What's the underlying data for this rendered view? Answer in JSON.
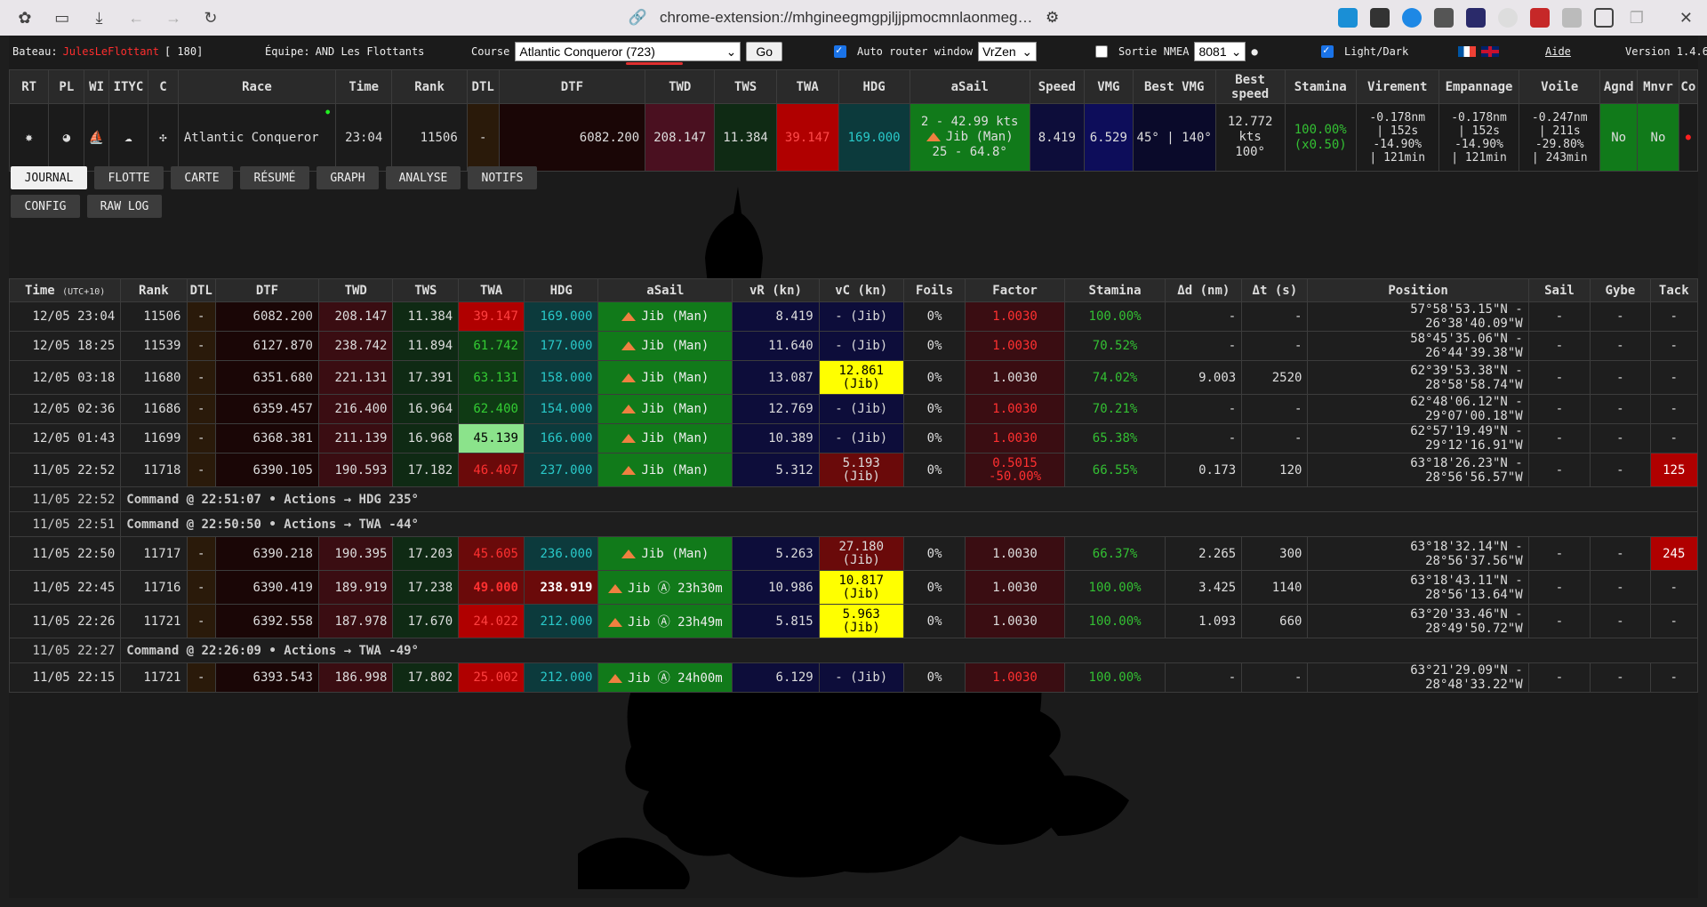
{
  "browser": {
    "url": "chrome-extension://mhgineegmgpjljjpmocmnlaonmegjkdc"
  },
  "topbar": {
    "bateau_label": "Bateau:",
    "bateau_name": "JulesLeFlottant",
    "bateau_extra": "[ 180]",
    "equipe_label": "Équipe:",
    "equipe_value": "AND Les Flottants",
    "course_label": "Course",
    "course_value": "Atlantic Conqueror (723)",
    "go_label": "Go",
    "auto_router_label": "Auto router window",
    "router_value": "VrZen",
    "sortie_label": "Sortie NMEA",
    "port_value": "8081",
    "lightdark_label": "Light/Dark",
    "aide_label": "Aide",
    "version_label": "Version 1.4.6"
  },
  "summary": {
    "headers": [
      "RT",
      "PL",
      "WI",
      "ITYC",
      "C",
      "Race",
      "Time",
      "Rank",
      "DTL",
      "DTF",
      "TWD",
      "TWS",
      "TWA",
      "HDG",
      "aSail",
      "Speed",
      "VMG",
      "Best VMG",
      "Best speed",
      "Stamina",
      "Virement",
      "Empannage",
      "Voile",
      "Agnd",
      "Mnvr",
      "Co"
    ],
    "race": "Atlantic Conqueror",
    "time": "23:04",
    "rank": "11506",
    "dtl": "-",
    "dtf": "6082.200",
    "twd": "208.147",
    "tws": "11.384",
    "twa": "39.147",
    "hdg": "169.000",
    "asail_1": "2 - 42.99 kts",
    "asail_2": "Jib (Man)",
    "asail_3": "25 - 64.8°",
    "speed": "8.419",
    "vmg": "6.529",
    "best_vmg": "45° | 140°",
    "best_speed_1": "12.772",
    "best_speed_2": "kts",
    "best_speed_3": "100°",
    "stamina_1": "100.00%",
    "stamina_2": "(x0.50)",
    "virement_1": "-0.178nm",
    "virement_2": "| 152s",
    "virement_3": "-14.90%",
    "virement_4": "| 121min",
    "empannage_1": "-0.178nm",
    "empannage_2": "| 152s",
    "empannage_3": "-14.90%",
    "empannage_4": "| 121min",
    "voile_1": "-0.247nm",
    "voile_2": "| 211s",
    "voile_3": "-29.80%",
    "voile_4": "| 243min",
    "agnd": "No",
    "mnvr": "No"
  },
  "tabs": {
    "row1": [
      "JOURNAL",
      "FLOTTE",
      "CARTE",
      "RÉSUMÉ",
      "GRAPH",
      "ANALYSE",
      "NOTIFS"
    ],
    "row2": [
      "CONFIG",
      "RAW LOG"
    ]
  },
  "log": {
    "headers": [
      "Time",
      "Rank",
      "DTL",
      "DTF",
      "TWD",
      "TWS",
      "TWA",
      "HDG",
      "aSail",
      "vR (kn)",
      "vC (kn)",
      "Foils",
      "Factor",
      "Stamina",
      "Δd (nm)",
      "Δt (s)",
      "Position",
      "Sail",
      "Gybe",
      "Tack"
    ],
    "time_sub": "(UTC+10)",
    "rows": [
      {
        "time": "12/05 23:04",
        "rank": "11506",
        "dtl": "-",
        "dtf": "6082.200",
        "twd": "208.147",
        "tws": "11.384",
        "twa": "39.147",
        "hdg": "169.000",
        "sail": "Jib (Man)",
        "vr": "8.419",
        "vc": "- (Jib)",
        "foils": "0%",
        "factor": "1.0030",
        "stamina": "100.00%",
        "dd": "-",
        "dt": "-",
        "pos": "57°58'53.15\"N - 26°38'40.09\"W",
        "s": "-",
        "g": "-",
        "t": "-"
      },
      {
        "time": "12/05 18:25",
        "rank": "11539",
        "dtl": "-",
        "dtf": "6127.870",
        "twd": "238.742",
        "tws": "11.894",
        "twa": "61.742",
        "hdg": "177.000",
        "sail": "Jib (Man)",
        "vr": "11.640",
        "vc": "- (Jib)",
        "foils": "0%",
        "factor": "1.0030",
        "stamina": "70.52%",
        "dd": "-",
        "dt": "-",
        "pos": "58°45'35.06\"N - 26°44'39.38\"W",
        "s": "-",
        "g": "-",
        "t": "-"
      },
      {
        "time": "12/05 03:18",
        "rank": "11680",
        "dtl": "-",
        "dtf": "6351.680",
        "twd": "221.131",
        "tws": "17.391",
        "twa": "63.131",
        "hdg": "158.000",
        "sail": "Jib (Man)",
        "vr": "13.087",
        "vc1": "12.861",
        "vc2": "(Jib)",
        "foils": "0%",
        "factor": "1.0030",
        "stamina": "74.02%",
        "dd": "9.003",
        "dt": "2520",
        "pos": "62°39'53.38\"N - 28°58'58.74\"W",
        "s": "-",
        "g": "-",
        "t": "-"
      },
      {
        "time": "12/05 02:36",
        "rank": "11686",
        "dtl": "-",
        "dtf": "6359.457",
        "twd": "216.400",
        "tws": "16.964",
        "twa": "62.400",
        "hdg": "154.000",
        "sail": "Jib (Man)",
        "vr": "12.769",
        "vc": "- (Jib)",
        "foils": "0%",
        "factor": "1.0030",
        "stamina": "70.21%",
        "dd": "-",
        "dt": "-",
        "pos": "62°48'06.12\"N - 29°07'00.18\"W",
        "s": "-",
        "g": "-",
        "t": "-"
      },
      {
        "time": "12/05 01:43",
        "rank": "11699",
        "dtl": "-",
        "dtf": "6368.381",
        "twd": "211.139",
        "tws": "16.968",
        "twa": "45.139",
        "hdg": "166.000",
        "sail": "Jib (Man)",
        "vr": "10.389",
        "vc": "- (Jib)",
        "foils": "0%",
        "factor": "1.0030",
        "stamina": "65.38%",
        "dd": "-",
        "dt": "-",
        "pos": "62°57'19.49\"N - 29°12'16.91\"W",
        "s": "-",
        "g": "-",
        "t": "-"
      },
      {
        "time": "11/05 22:52",
        "rank": "11718",
        "dtl": "-",
        "dtf": "6390.105",
        "twd": "190.593",
        "tws": "17.182",
        "twa": "46.407",
        "hdg": "237.000",
        "sail": "Jib (Man)",
        "vr": "5.312",
        "vc1": "5.193",
        "vc2": "(Jib)",
        "foils": "0%",
        "factor1": "0.5015",
        "factor2": "-50.00%",
        "stamina": "66.55%",
        "dd": "0.173",
        "dt": "120",
        "pos": "63°18'26.23\"N - 28°56'56.57\"W",
        "s": "-",
        "g": "-",
        "t": "125"
      },
      {
        "time": "11/05 22:52",
        "cmd": "Command @ 22:51:07 • Actions → HDG 235°"
      },
      {
        "time": "11/05 22:51",
        "cmd": "Command @ 22:50:50 • Actions → TWA -44°"
      },
      {
        "time": "11/05 22:50",
        "rank": "11717",
        "dtl": "-",
        "dtf": "6390.218",
        "twd": "190.395",
        "tws": "17.203",
        "twa": "45.605",
        "hdg": "236.000",
        "sail": "Jib (Man)",
        "vr": "5.263",
        "vc1": "27.180",
        "vc2": "(Jib)",
        "foils": "0%",
        "factor": "1.0030",
        "stamina": "66.37%",
        "dd": "2.265",
        "dt": "300",
        "pos": "63°18'32.14\"N - 28°56'37.56\"W",
        "s": "-",
        "g": "-",
        "t": "245"
      },
      {
        "time": "11/05 22:45",
        "rank": "11716",
        "dtl": "-",
        "dtf": "6390.419",
        "twd": "189.919",
        "tws": "17.238",
        "twa": "49.000",
        "hdg": "238.919",
        "sail": "Jib Ⓐ 23h30m",
        "vr": "10.986",
        "vc1": "10.817",
        "vc2": "(Jib)",
        "foils": "0%",
        "factor": "1.0030",
        "stamina": "100.00%",
        "dd": "3.425",
        "dt": "1140",
        "pos": "63°18'43.11\"N - 28°56'13.64\"W",
        "s": "-",
        "g": "-",
        "t": "-"
      },
      {
        "time": "11/05 22:26",
        "rank": "11721",
        "dtl": "-",
        "dtf": "6392.558",
        "twd": "187.978",
        "tws": "17.670",
        "twa": "24.022",
        "hdg": "212.000",
        "sail": "Jib Ⓐ 23h49m",
        "vr": "5.815",
        "vc1": "5.963",
        "vc2": "(Jib)",
        "foils": "0%",
        "factor": "1.0030",
        "stamina": "100.00%",
        "dd": "1.093",
        "dt": "660",
        "pos": "63°20'33.46\"N - 28°49'50.72\"W",
        "s": "-",
        "g": "-",
        "t": "-"
      },
      {
        "time": "11/05 22:27",
        "cmd": "Command @ 22:26:09 • Actions → TWA -49°"
      },
      {
        "time": "11/05 22:15",
        "rank": "11721",
        "dtl": "-",
        "dtf": "6393.543",
        "twd": "186.998",
        "tws": "17.802",
        "twa": "25.002",
        "hdg": "212.000",
        "sail": "Jib Ⓐ 24h00m",
        "vr": "6.129",
        "vc": "- (Jib)",
        "foils": "0%",
        "factor": "1.0030",
        "stamina": "100.00%",
        "dd": "-",
        "dt": "-",
        "pos": "63°21'29.09\"N - 28°48'33.22\"W",
        "s": "-",
        "g": "-",
        "t": "-"
      }
    ]
  }
}
